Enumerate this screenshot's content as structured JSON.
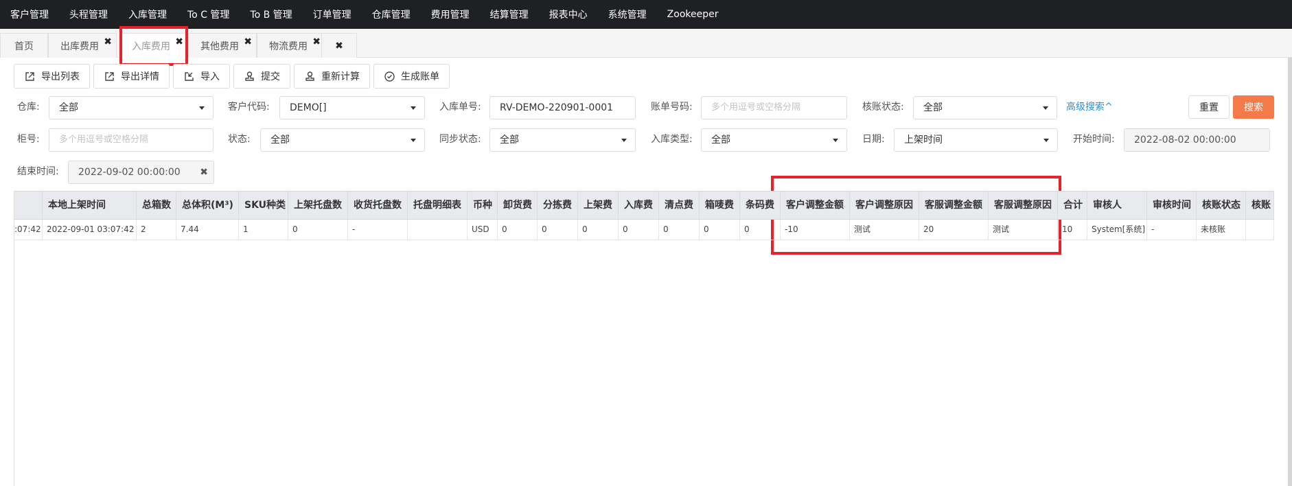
{
  "topnav": {
    "items": [
      "客户管理",
      "头程管理",
      "入库管理",
      "To C 管理",
      "To B 管理",
      "订单管理",
      "仓库管理",
      "费用管理",
      "结算管理",
      "报表中心",
      "系统管理",
      "Zookeeper"
    ]
  },
  "tabs": [
    {
      "label": "首页",
      "closable": false,
      "active": false
    },
    {
      "label": "出库费用",
      "closable": true,
      "active": false
    },
    {
      "label": "入库费用",
      "closable": true,
      "active": true
    },
    {
      "label": "其他费用",
      "closable": true,
      "active": false
    },
    {
      "label": "物流费用",
      "closable": true,
      "active": false
    }
  ],
  "close_symbol": "✖",
  "toolbar": {
    "export_list": "导出列表",
    "export_detail": "导出详情",
    "import": "导入",
    "submit": "提交",
    "recalc": "重新计算",
    "generate_bill": "生成账单"
  },
  "filters": {
    "warehouse_label": "仓库:",
    "warehouse_value": "全部",
    "customer_code_label": "客户代码:",
    "customer_code_value": "DEMO[]",
    "inbound_no_label": "入库单号:",
    "inbound_no_value": "RV-DEMO-220901-0001",
    "bill_no_label": "账单号码:",
    "bill_no_placeholder": "多个用逗号或空格分隔",
    "reconcile_status_label": "核账状态:",
    "reconcile_status_value": "全部",
    "advanced_search": "高级搜索^",
    "reset": "重置",
    "search": "搜索",
    "container_no_label": "柜号:",
    "container_no_placeholder": "多个用逗号或空格分隔",
    "status_label": "状态:",
    "status_value": "全部",
    "sync_status_label": "同步状态:",
    "sync_status_value": "全部",
    "inbound_type_label": "入库类型:",
    "inbound_type_value": "全部",
    "date_label": "日期:",
    "date_value": "上架时间",
    "start_time_label": "开始时间:",
    "start_time_value": "2022-08-02 00:00:00",
    "end_time_label": "结束时间:",
    "end_time_value": "2022-09-02 00:00:00",
    "clear_symbol": "✖"
  },
  "table": {
    "headers": [
      "",
      "本地上架时间",
      "总箱数",
      "总体积(M³)",
      "SKU种类",
      "上架托盘数",
      "收货托盘数",
      "托盘明细表",
      "币种",
      "卸货费",
      "分拣费",
      "上架费",
      "入库费",
      "清点费",
      "箱唛费",
      "条码费",
      "客户调整金额",
      "客户调整原因",
      "客服调整金额",
      "客服调整原因",
      "合计",
      "审核人",
      "审核时间",
      "核账状态",
      "核账"
    ],
    "rows": [
      [
        ":07:42",
        "2022-09-01 03:07:42",
        "2",
        "7.44",
        "1",
        "0",
        "-",
        "",
        "USD",
        "0",
        "0",
        "0",
        "0",
        "0",
        "0",
        "0",
        "-10",
        "测试",
        "20",
        "测试",
        "10",
        "System[系统]",
        "-",
        "未核账",
        ""
      ]
    ]
  }
}
